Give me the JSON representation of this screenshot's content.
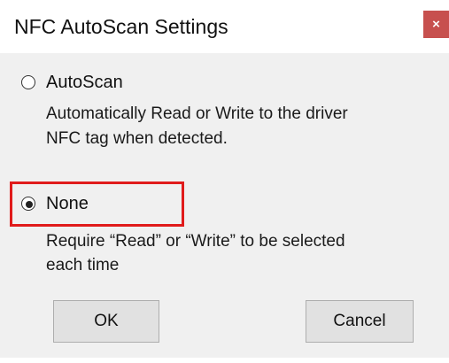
{
  "window": {
    "title": "NFC AutoScan Settings",
    "close_glyph": "×"
  },
  "options": [
    {
      "label": "AutoScan",
      "selected": false,
      "description_lines": [
        "Automatically Read or Write to the driver",
        "NFC tag when detected."
      ]
    },
    {
      "label": "None",
      "selected": true,
      "description_lines": [
        "Require “Read” or “Write” to be selected",
        "each time"
      ]
    }
  ],
  "buttons": {
    "ok_label": "OK",
    "cancel_label": "Cancel"
  },
  "colors": {
    "highlight": "#e01b1b",
    "close_button": "#c7504e"
  }
}
